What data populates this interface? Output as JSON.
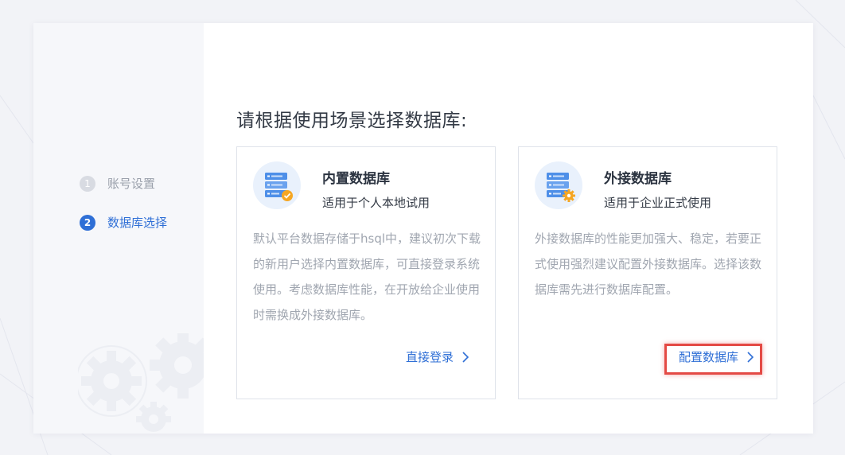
{
  "sidebar": {
    "steps": [
      {
        "number": "1",
        "label": "账号设置",
        "state": "inactive"
      },
      {
        "number": "2",
        "label": "数据库选择",
        "state": "active"
      }
    ]
  },
  "main": {
    "heading": "请根据使用场景选择数据库:",
    "cards": [
      {
        "icon": "database-server-check-icon",
        "title": "内置数据库",
        "subtitle": "适用于个人本地试用",
        "description": "默认平台数据存储于hsql中，建议初次下载的新用户选择内置数据库，可直接登录系统使用。考虑数据库性能，在开放给企业使用时需换成外接数据库。",
        "action_label": "直接登录"
      },
      {
        "icon": "database-server-gear-icon",
        "title": "外接数据库",
        "subtitle": "适用于企业正式使用",
        "description": "外接数据库的性能更加强大、稳定，若要正式使用强烈建议配置外接数据库。选择该数据库需先进行数据库配置。",
        "action_label": "配置数据库",
        "highlighted": true
      }
    ]
  },
  "colors": {
    "accent": "#2f6fd6",
    "highlight_border": "#e44a45",
    "muted_text": "#a0a6b0",
    "page_background": "#f2f3f7"
  }
}
